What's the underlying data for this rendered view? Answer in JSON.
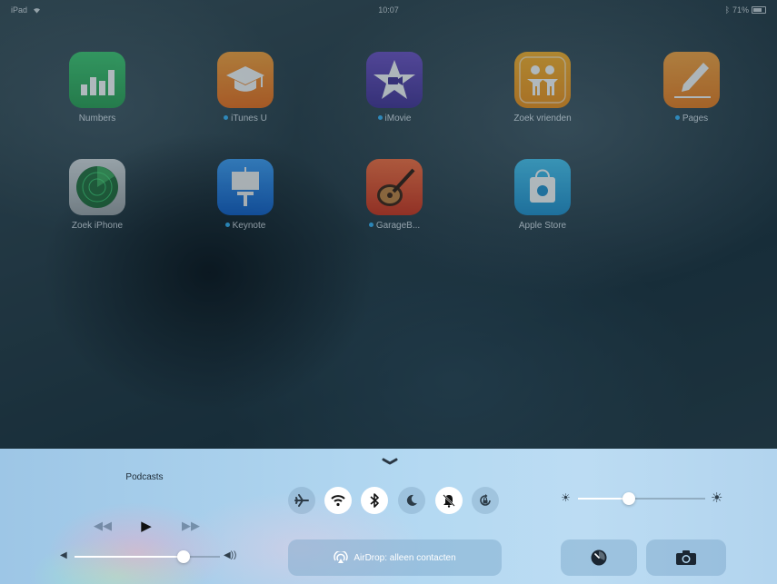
{
  "status_bar": {
    "device": "iPad",
    "time": "10:07",
    "battery": "71%",
    "battery_level": 0.71
  },
  "apps": [
    {
      "label": "Numbers",
      "icon": "numbers-icon",
      "badge_dot": false
    },
    {
      "label": "iTunes U",
      "icon": "itunes-u-icon",
      "badge_dot": true
    },
    {
      "label": "iMovie",
      "icon": "imovie-icon",
      "badge_dot": true
    },
    {
      "label": "Zoek vrienden",
      "icon": "find-friends-icon",
      "badge_dot": false
    },
    {
      "label": "Pages",
      "icon": "pages-icon",
      "badge_dot": true
    },
    {
      "label": "Zoek iPhone",
      "icon": "find-iphone-icon",
      "badge_dot": false
    },
    {
      "label": "Keynote",
      "icon": "keynote-icon",
      "badge_dot": true
    },
    {
      "label": "GarageB...",
      "icon": "garageband-icon",
      "badge_dot": true
    },
    {
      "label": "Apple Store",
      "icon": "apple-store-icon",
      "badge_dot": false
    }
  ],
  "control_center": {
    "now_playing": "Podcasts",
    "media": {
      "prev": "rewind-icon",
      "play": "play-icon",
      "next": "fast-forward-icon"
    },
    "volume_level": 0.75,
    "brightness_level": 0.4,
    "toggles": [
      {
        "icon": "airplane-icon",
        "on": false
      },
      {
        "icon": "wifi-icon",
        "on": true
      },
      {
        "icon": "bluetooth-icon",
        "on": true
      },
      {
        "icon": "moon-icon",
        "on": false
      },
      {
        "icon": "bell-mute-icon",
        "on": true
      },
      {
        "icon": "rotation-lock-icon",
        "on": false
      }
    ],
    "airdrop_label": "AirDrop: alleen contacten",
    "buttons": {
      "timer": "timer-icon",
      "camera": "camera-icon"
    }
  },
  "colors": {
    "cc_background": "#b4d9f2",
    "toggle_on": "#ffffff",
    "badge_dot": "#2f9bd6"
  }
}
